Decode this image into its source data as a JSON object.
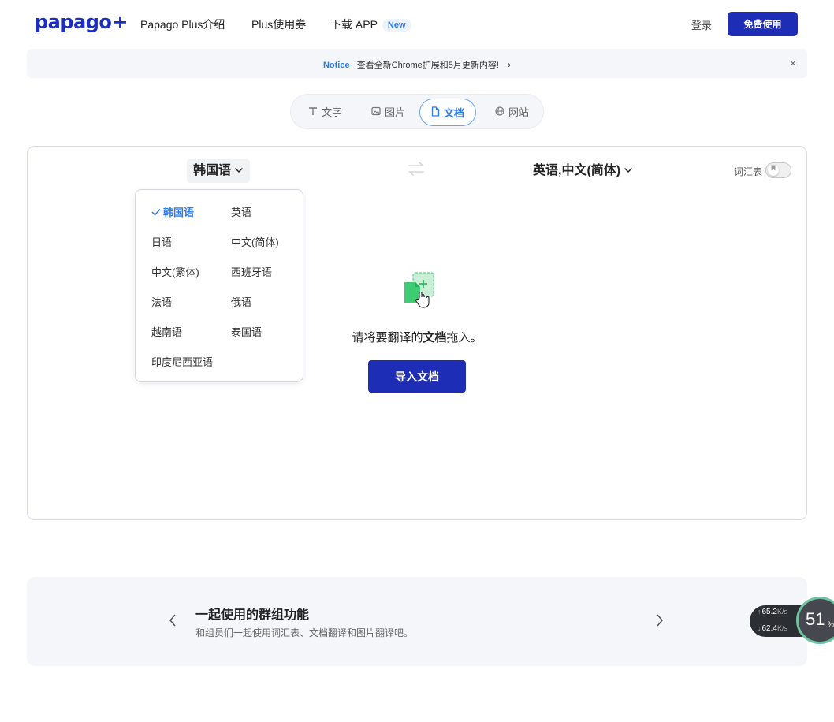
{
  "header": {
    "logo": "papago",
    "logo_plus": "+",
    "nav": {
      "intro": "Papago Plus介绍",
      "coupon": "Plus使用券",
      "app": "下载 APP",
      "app_badge": "New"
    },
    "login": "登录",
    "free_use": "免费使用"
  },
  "notice": {
    "tag": "Notice",
    "text": "查看全新Chrome扩展和5月更新内容!",
    "chevron": "›",
    "close": "×"
  },
  "tabs": [
    {
      "label": "文字",
      "icon": "text-icon"
    },
    {
      "label": "图片",
      "icon": "image-icon"
    },
    {
      "label": "文档",
      "icon": "document-icon",
      "active": true
    },
    {
      "label": "网站",
      "icon": "globe-icon"
    }
  ],
  "translator": {
    "source_lang": "韩国语",
    "target_lang": "英语,中文(简体)",
    "glossary_label": "词汇表"
  },
  "dropdown": {
    "items": [
      "韩国语",
      "英语",
      "日语",
      "中文(简体)",
      "中文(繁体)",
      "西班牙语",
      "法语",
      "俄语",
      "越南语",
      "泰国语",
      "印度尼西亚语"
    ],
    "selected": "韩国语"
  },
  "drop_area": {
    "text_before": "请将要翻译的",
    "text_bold": "文档",
    "text_after": "拖入。",
    "import_button": "导入文档"
  },
  "promo": {
    "title": "一起使用的群组功能",
    "description": "和组员们一起使用词汇表、文档翻译和图片翻译吧。"
  },
  "net_widget": {
    "up_value": "65.2",
    "down_value": "62.4",
    "unit": "K/s",
    "cpu_value": "51",
    "cpu_unit": "%"
  },
  "colors": {
    "primary": "#1e2db5",
    "accent": "#2e7be8",
    "notice_bg": "#f4f6f9"
  }
}
